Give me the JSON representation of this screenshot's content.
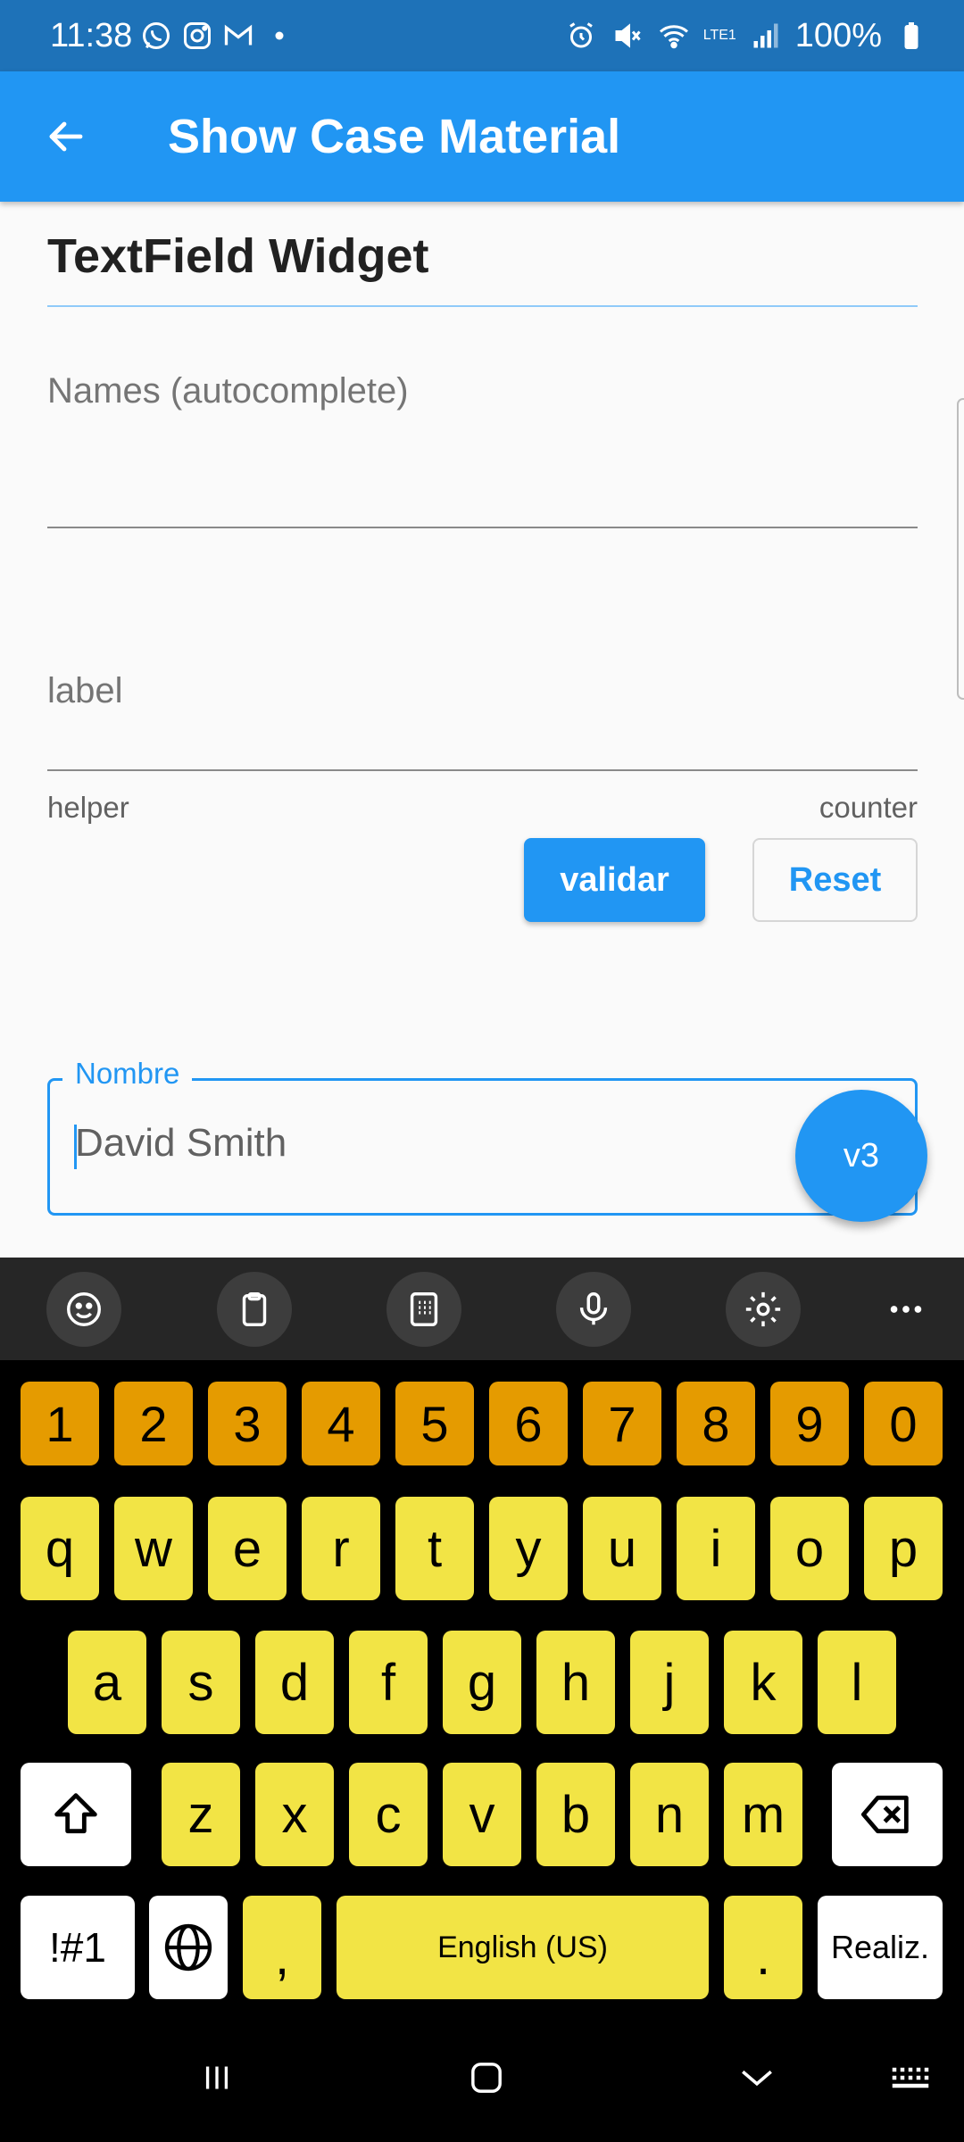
{
  "status_bar": {
    "time": "11:38",
    "battery": "100%",
    "network": "LTE1"
  },
  "app_bar": {
    "title": "Show Case Material"
  },
  "content": {
    "section_title": "TextField Widget",
    "names_field": {
      "hint": "Names (autocomplete)"
    },
    "label_field": {
      "hint": "label",
      "helper": "helper",
      "counter": "counter"
    },
    "validate_button": "validar",
    "reset_button": "Reset",
    "outlined_field": {
      "label": "Nombre",
      "value": "David Smith"
    },
    "fab_label": "v3"
  },
  "keyboard": {
    "number_row": [
      "1",
      "2",
      "3",
      "4",
      "5",
      "6",
      "7",
      "8",
      "9",
      "0"
    ],
    "row1": [
      "q",
      "w",
      "e",
      "r",
      "t",
      "y",
      "u",
      "i",
      "o",
      "p"
    ],
    "row2": [
      "a",
      "s",
      "d",
      "f",
      "g",
      "h",
      "j",
      "k",
      "l"
    ],
    "row3": [
      "z",
      "x",
      "c",
      "v",
      "b",
      "n",
      "m"
    ],
    "symbols_key": "!#1",
    "comma_key": ",",
    "space_label": "English (US)",
    "period_key": ".",
    "enter_key": "Realiz.",
    "toolbar_icons": [
      "emoji-icon",
      "clipboard-icon",
      "keypad-icon",
      "mic-icon",
      "settings-icon",
      "more-icon"
    ],
    "colors": {
      "number_keys": "#e59b00",
      "letter_keys": "#f2e445",
      "function_keys": "#ffffff",
      "background": "#000000"
    }
  },
  "colors": {
    "primary": "#2196f3",
    "status_bar": "#1e72b8"
  }
}
